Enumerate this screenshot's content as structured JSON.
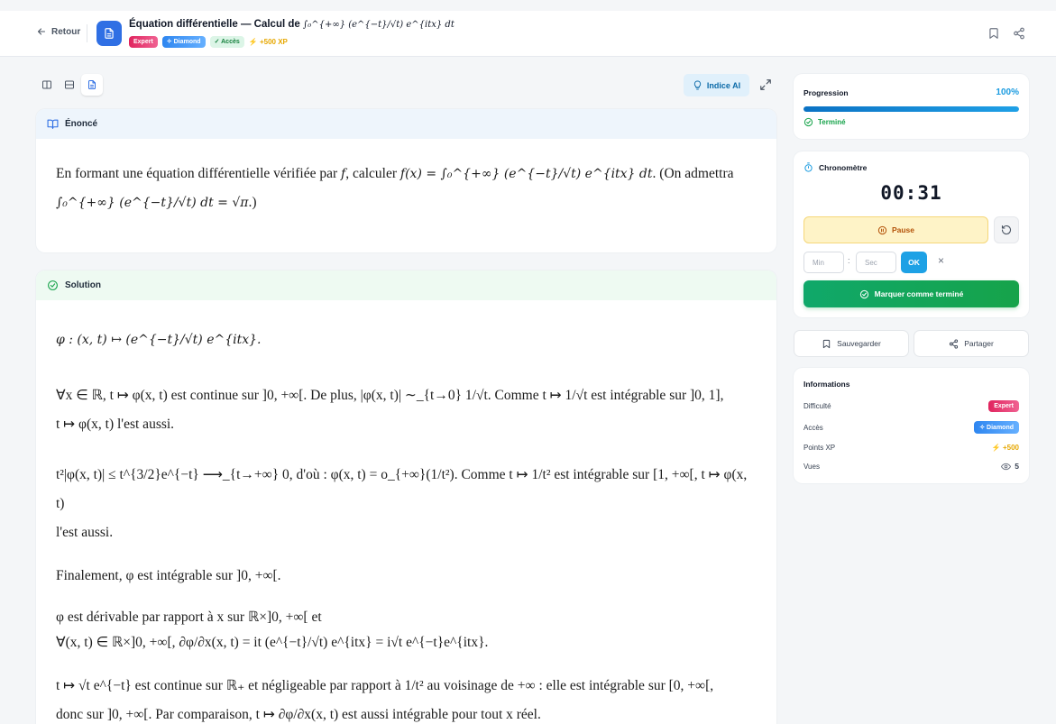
{
  "header": {
    "back_label": "Retour",
    "title_text": "Équation différentielle — Calcul de",
    "title_math": "∫₀^{+∞} (e^{−t}/√t) e^{itx} dt",
    "badges": {
      "expert": "Expert",
      "diamond": "Diamond",
      "acces": "Accès",
      "xp": "+500 XP"
    }
  },
  "toolbar": {
    "hint_label": "Indice AI"
  },
  "enonce": {
    "heading": "Énoncé",
    "text_1": "En formant une équation différentielle vérifiée par",
    "text_2": ", calculer",
    "text_3": ". (On admettra",
    "text_4": ".)",
    "math_f": "f",
    "math_fx": "f(x) = ∫₀^{+∞} (e^{−t}/√t) e^{itx} dt",
    "math_admit": "∫₀^{+∞} (e^{−t}/√t) dt = √π"
  },
  "solution": {
    "heading": "Solution",
    "p1": "φ : (x, t) ↦ (e^{−t}/√t) e^{itx}.",
    "p2a": "∀x ∈ ℝ, t ↦ φ(x, t) est continue sur ]0, +∞[. De plus, |φ(x, t)| ∼_{t→0} 1/√t. Comme t ↦ 1/√t est intégrable sur ]0, 1],",
    "p2b": "t ↦ φ(x, t) l'est aussi.",
    "p3a": "t²|φ(x, t)| ≤ t^{3/2}e^{−t} ⟶_{t→+∞} 0, d'où : φ(x, t) = o_{+∞}(1/t²). Comme t ↦ 1/t² est intégrable sur [1, +∞[, t ↦ φ(x, t)",
    "p3b": "l'est aussi.",
    "p4": "Finalement, φ est intégrable sur ]0, +∞[.",
    "p5a": "φ est dérivable par rapport à x sur ℝ×]0, +∞[ et",
    "p5b": "∀(x, t) ∈ ℝ×]0, +∞[, ∂φ/∂x(x, t) = it (e^{−t}/√t) e^{itx} = i√t e^{−t}e^{itx}.",
    "p6a": "t ↦ √t e^{−t} est continue sur ℝ₊ et négligeable par rapport à 1/t² au voisinage de +∞ : elle est intégrable sur [0, +∞[,",
    "p6b": "donc sur ]0, +∞[. Par comparaison, t ↦ ∂φ/∂x(x, t) est aussi intégrable pour tout x réel."
  },
  "progress": {
    "label": "Progression",
    "percent_label": "100%",
    "value": 1.0,
    "status": "Terminé"
  },
  "timer": {
    "label": "Chronomètre",
    "display": "00:31",
    "pause_label": "Pause",
    "min_placeholder": "Min",
    "sec_placeholder": "Sec",
    "colon": ":",
    "ok_label": "OK",
    "clear_label": "×",
    "mark_done_label": "Marquer comme terminé"
  },
  "actions": {
    "save_label": "Sauvegarder",
    "share_label": "Partager"
  },
  "info": {
    "heading": "Informations",
    "rows": [
      {
        "label": "Difficulté",
        "value": "Expert"
      },
      {
        "label": "Accès",
        "value": "Diamond"
      },
      {
        "label": "Points XP",
        "value": "+500"
      },
      {
        "label": "Vues",
        "value": "5"
      }
    ]
  },
  "colors": {
    "accent": "#2f6fe4",
    "success": "#16a34a",
    "expert": "#e0245e",
    "diamond": "#2e86f0",
    "xp": "#e6a700"
  }
}
